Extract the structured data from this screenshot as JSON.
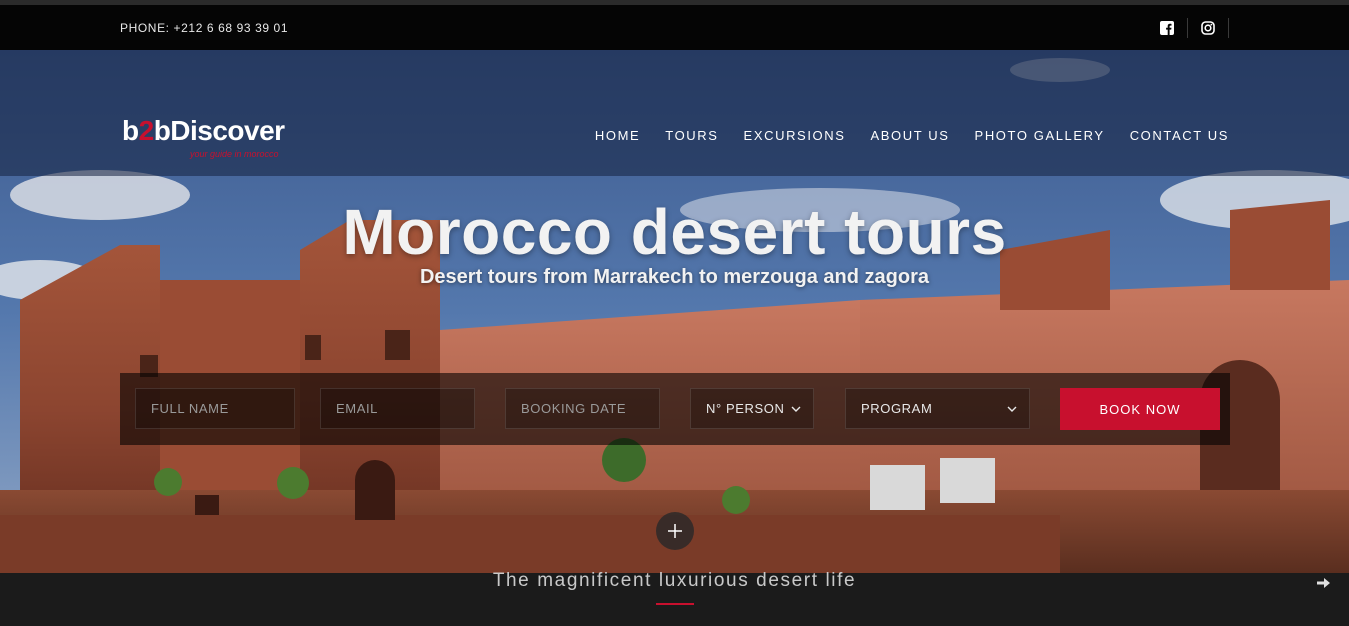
{
  "topbar": {
    "phone": "PHONE: +212 6 68 93 39 01",
    "social": [
      {
        "name": "facebook-icon"
      },
      {
        "name": "instagram-icon"
      }
    ]
  },
  "brand": {
    "logo_part1": "b",
    "logo_part2": "2",
    "logo_part3": "bDiscover",
    "tagline": "your guide in morocco",
    "accent_color": "#c8102e"
  },
  "nav": {
    "items": [
      "HOME",
      "TOURS",
      "EXCURSIONS",
      "ABOUT US",
      "PHOTO GALLERY",
      "CONTACT US"
    ]
  },
  "hero": {
    "title": "Morocco desert tours",
    "subtitle": "Desert tours from Marrakech to merzouga and zagora"
  },
  "booking": {
    "full_name_placeholder": "FULL NAME",
    "email_placeholder": "EMAIL",
    "date_placeholder": "BOOKING DATE",
    "person_selected": "N° PERSON",
    "program_selected": "PROGRAM",
    "submit_label": "BOOK NOW"
  },
  "section": {
    "heading": "The magnificent luxurious desert life"
  }
}
